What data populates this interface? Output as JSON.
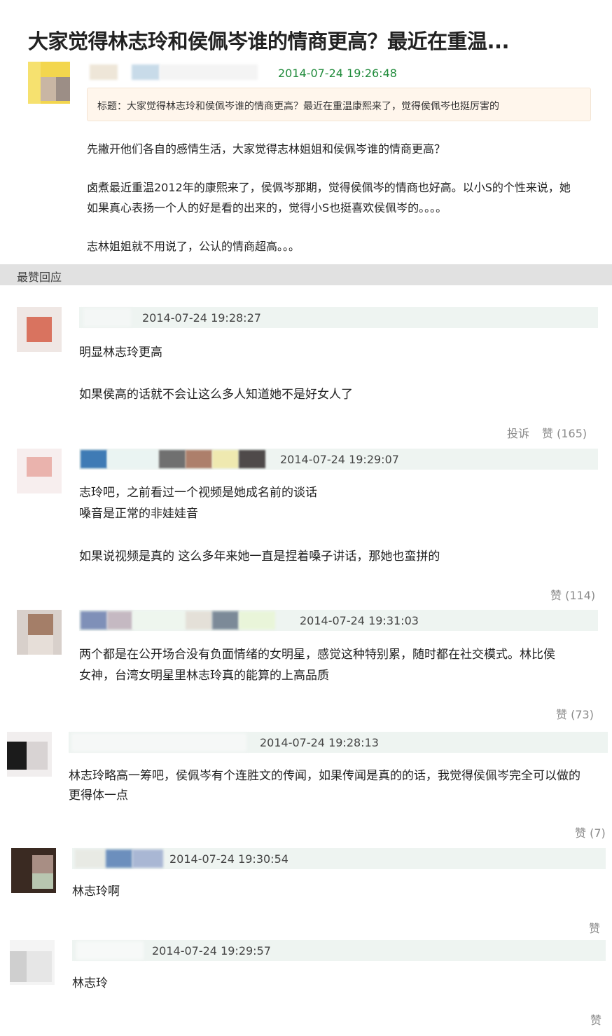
{
  "post": {
    "title": "大家觉得林志玲和侯佩岑谁的情商更高？最近在重温...",
    "time": "2014-07-24 19:26:48",
    "quote": "标题：大家觉得林志玲和侯佩岑谁的情商更高？最近在重温康熙来了，觉得侯佩岑也挺厉害的",
    "paragraphs": [
      "先撇开他们各自的感情生活，大家觉得志林姐姐和侯佩岑谁的情商更高？",
      "卤煮最近重温2012年的康熙来了，侯佩岑那期，觉得侯佩岑的情商也好高。以小S的个性来说，她",
      "如果真心表扬一个人的好是看的出来的，觉得小S也挺喜欢侯佩岑的。。。。",
      "志林姐姐就不用说了，公认的情商超高。。。"
    ]
  },
  "section_label": "最赞回应",
  "comments": [
    {
      "time": "2014-07-24 19:28:27",
      "lines": [
        "明显林志玲更高",
        "如果侯高的话就不会让这么多人知道她不是好女人了"
      ],
      "report": "投诉",
      "like": "赞 (165)"
    },
    {
      "time": "2014-07-24 19:29:07",
      "lines": [
        "志玲吧，之前看过一个视频是她成名前的谈话",
        "嗓音是正常的非娃娃音",
        "如果说视频是真的 这么多年来她一直是捏着嗓子讲话，那她也蛮拼的"
      ],
      "like": "赞 (114)"
    },
    {
      "time": "2014-07-24 19:31:03",
      "lines": [
        "两个都是在公开场合没有负面情绪的女明星，感觉这种特别累，随时都在社交模式。林比侯",
        "女神，台湾女明星里林志玲真的能算的上高品质"
      ],
      "like": "赞 (73)"
    },
    {
      "time": "2014-07-24 19:28:13",
      "lines": [
        "林志玲略高一筹吧，侯佩岑有个连胜文的传闻，如果传闻是真的的话，我觉得侯佩岑完全可以做的",
        "更得体一点"
      ],
      "like": "赞 (7)"
    },
    {
      "time": "2014-07-24 19:30:54",
      "lines": [
        "林志玲啊"
      ],
      "like": "赞"
    },
    {
      "time": "2014-07-24 19:29:57",
      "lines": [
        "林志玲"
      ],
      "like": "赞"
    }
  ],
  "colors": {
    "op_time": "#1f8a3a",
    "header_bg": "#eef4f1",
    "section_bg": "#e1e1e1",
    "quote_bg": "#fff6ec"
  }
}
